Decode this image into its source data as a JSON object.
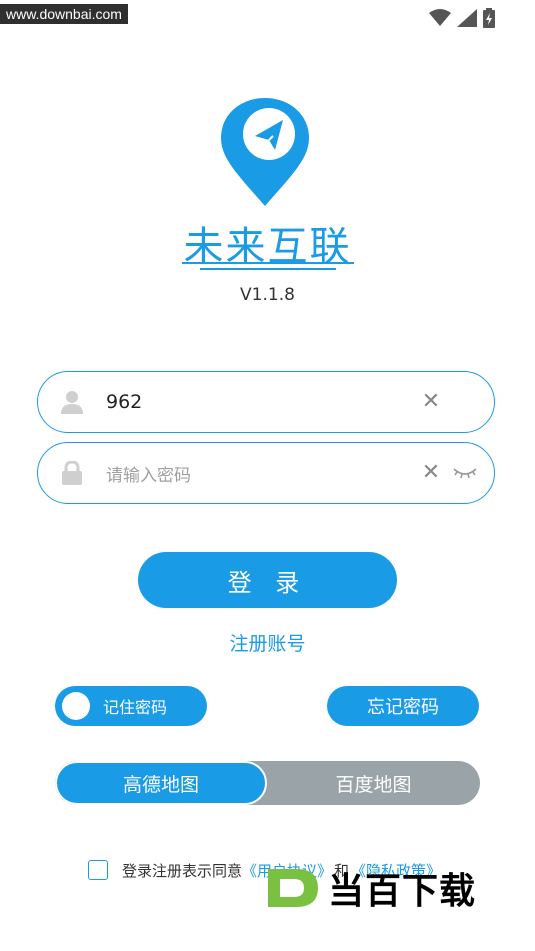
{
  "watermark": "www.downbai.com",
  "app": {
    "name": "未来互联",
    "version": "V1.1.8"
  },
  "login": {
    "username_value": "962",
    "password_placeholder": "请输入密码",
    "clear_symbol": "✕",
    "login_label": "登 录",
    "register_label": "注册账号"
  },
  "options": {
    "remember_label": "记住密码",
    "forgot_label": "忘记密码"
  },
  "map": {
    "options": [
      "高德地图",
      "百度地图"
    ],
    "selected": "高德地图"
  },
  "agreement": {
    "text": "登录注册表示同意",
    "user_agreement": "《用户协议》",
    "and": "和",
    "privacy": "《隐私政策》"
  },
  "brand_text": "当百下载",
  "colors": {
    "accent": "#1a9be6",
    "inactive": "#9aa3a8"
  },
  "icons": [
    "user-icon",
    "lock-icon",
    "clear-icon",
    "eye-closed-icon",
    "wifi-icon",
    "signal-icon",
    "battery-icon",
    "location-pin-icon"
  ]
}
